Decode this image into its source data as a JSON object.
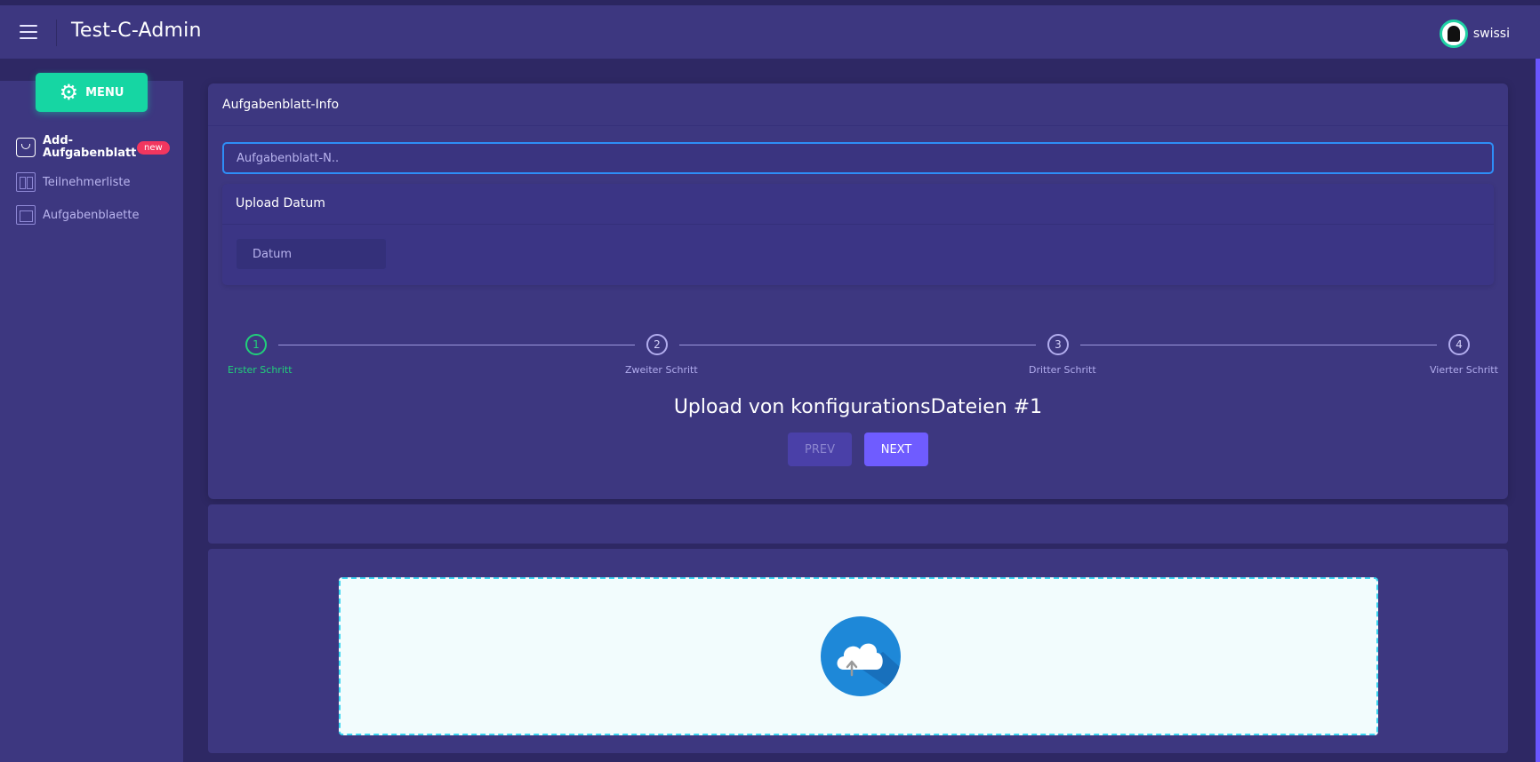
{
  "header": {
    "app_title": "Test-C-Admin",
    "username": "swissi"
  },
  "sidebar": {
    "menu_label": "MENU",
    "items": [
      {
        "label": "Add-Aufgabenblatt",
        "badge": "new",
        "icon": "shopping-bag-icon",
        "active": true
      },
      {
        "label": "Teilnehmerliste",
        "icon": "columns-icon",
        "active": false
      },
      {
        "label": "Aufgabenblaette",
        "icon": "window-frame-icon",
        "active": false
      }
    ]
  },
  "main": {
    "card_title": "Aufgabenblatt-Info",
    "name_placeholder": "Aufgabenblatt-N..",
    "upload_date_title": "Upload Datum",
    "date_placeholder": "Datum",
    "steps": [
      {
        "number": "1",
        "label": "Erster Schritt",
        "active": true
      },
      {
        "number": "2",
        "label": "Zweiter Schritt",
        "active": false
      },
      {
        "number": "3",
        "label": "Dritter Schritt",
        "active": false
      },
      {
        "number": "4",
        "label": "Vierter Schritt",
        "active": false
      }
    ],
    "step_title": "Upload von konfigurationsDateien #1",
    "prev_label": "PREV",
    "next_label": "NEXT"
  },
  "upload": {
    "icon": "cloud-upload-icon"
  },
  "colors": {
    "background": "#2e2864",
    "panel": "#3d3780",
    "accent_green": "#16d6a3",
    "step_active": "#21d07a",
    "primary": "#6f5cff",
    "badge": "#f2365f",
    "input_focus": "#2e8ef7",
    "upload_blue": "#1e88d8"
  }
}
